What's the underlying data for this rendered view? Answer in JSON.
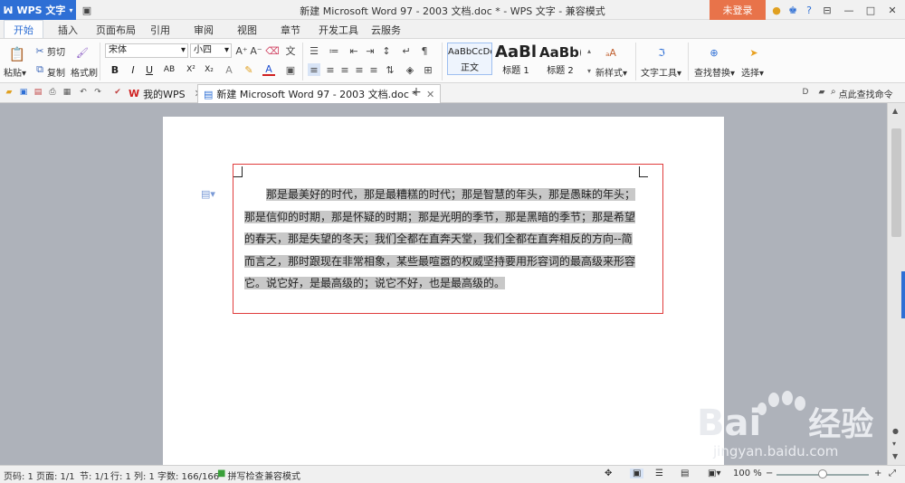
{
  "titlebar": {
    "app_name": "WPS 文字",
    "document_title": "新建 Microsoft Word 97 - 2003 文档.doc * - WPS 文字 - 兼容模式",
    "login_label": "未登录"
  },
  "menu_tabs": [
    "开始",
    "插入",
    "页面布局",
    "引用",
    "审阅",
    "视图",
    "章节",
    "开发工具",
    "云服务"
  ],
  "ribbon": {
    "paste_label": "粘贴",
    "cut_label": "剪切",
    "copy_label": "复制",
    "format_painter_label": "格式刷",
    "font_name": "宋体",
    "font_size": "小四",
    "styles": [
      {
        "preview": "AaBbCcDd",
        "label": "正文"
      },
      {
        "preview": "AaBl",
        "label": "标题 1"
      },
      {
        "preview": "AaBb(",
        "label": "标题 2"
      }
    ],
    "new_style_label": "新样式",
    "text_tools_label": "文字工具",
    "find_replace_label": "查找替换",
    "select_label": "选择"
  },
  "tabs": {
    "my_wps": "我的WPS",
    "document": "新建 Microsoft Word 97 - 2003 文档.doc *"
  },
  "search_command": "点此查找命令",
  "document": {
    "paragraph": "那是最美好的时代，那是最糟糕的时代；那是智慧的年头，那是愚昧的年头；那是信仰的时期，那是怀疑的时期；那是光明的季节，那是黑暗的季节；那是希望的春天，那是失望的冬天；我们全都在直奔天堂，我们全都在直奔相反的方向--简而言之，那时跟现在非常相象，某些最喧嚣的权威坚持要用形容词的最高级来形容它。说它好，是最高级的；说它不好，也是最高级的。"
  },
  "statusbar": {
    "page_number": "页码: 1",
    "page_count": "页面: 1/1",
    "section": "节: 1/1",
    "row": "行: 1",
    "column": "列: 1",
    "word_count": "字数: 166/166",
    "spell_check": "拼写检查",
    "compat_mode": "兼容模式",
    "zoom": "100 %"
  },
  "watermark": {
    "brand": "Bai",
    "brand_cn": "经验",
    "url": "jingyan.baidu.com"
  },
  "colors": {
    "accent": "#2e6fd5",
    "login": "#e8734a",
    "selection_box": "#e03c3c",
    "text_highlight": "#c8c8c8"
  }
}
